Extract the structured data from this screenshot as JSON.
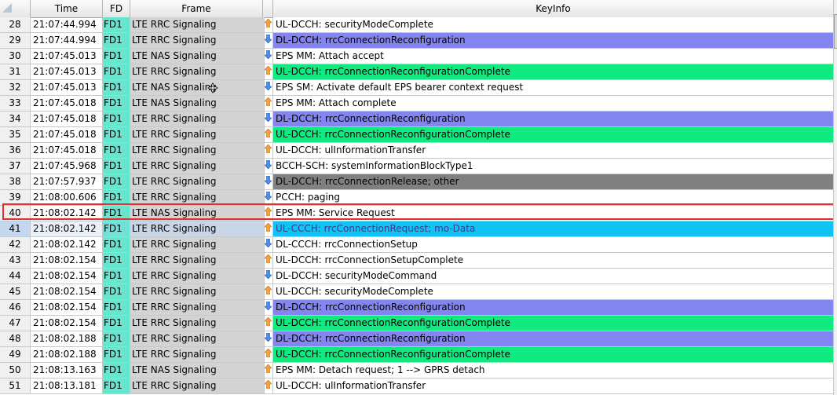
{
  "headers": {
    "time": "Time",
    "fd": "FD",
    "frame": "Frame",
    "keyinfo": "KeyInfo"
  },
  "colors": {
    "fd": "#66e6cf",
    "frame": "#d3d3d3",
    "purple": "#8585f2",
    "green": "#10ea80",
    "gray": "#808080",
    "cyan": "#11c3f5",
    "white": "#ffffff",
    "highlight_border": "#e03030"
  },
  "rows": [
    {
      "num": "28",
      "time": "21:07:44.994",
      "fd": "FD1",
      "frame": "LTE RRC Signaling",
      "dir": "up",
      "key": "UL-DCCH: securityModeComplete",
      "bg": "white"
    },
    {
      "num": "29",
      "time": "21:07:44.994",
      "fd": "FD1",
      "frame": "LTE RRC Signaling",
      "dir": "down",
      "key": "DL-DCCH: rrcConnectionReconfiguration",
      "bg": "purple"
    },
    {
      "num": "30",
      "time": "21:07:45.013",
      "fd": "FD1",
      "frame": "LTE NAS Signaling",
      "dir": "down",
      "key": "EPS MM: Attach accept",
      "bg": "white"
    },
    {
      "num": "31",
      "time": "21:07:45.013",
      "fd": "FD1",
      "frame": "LTE RRC Signaling",
      "dir": "up",
      "key": "UL-DCCH: rrcConnectionReconfigurationComplete",
      "bg": "green"
    },
    {
      "num": "32",
      "time": "21:07:45.013",
      "fd": "FD1",
      "frame": "LTE NAS Signaling",
      "dir": "down",
      "key": "EPS SM: Activate default EPS bearer context request",
      "bg": "white"
    },
    {
      "num": "33",
      "time": "21:07:45.018",
      "fd": "FD1",
      "frame": "LTE NAS Signaling",
      "dir": "up",
      "key": "EPS MM: Attach complete",
      "bg": "white"
    },
    {
      "num": "34",
      "time": "21:07:45.018",
      "fd": "FD1",
      "frame": "LTE RRC Signaling",
      "dir": "down",
      "key": "DL-DCCH: rrcConnectionReconfiguration",
      "bg": "purple"
    },
    {
      "num": "35",
      "time": "21:07:45.018",
      "fd": "FD1",
      "frame": "LTE RRC Signaling",
      "dir": "up",
      "key": "UL-DCCH: rrcConnectionReconfigurationComplete",
      "bg": "green"
    },
    {
      "num": "36",
      "time": "21:07:45.018",
      "fd": "FD1",
      "frame": "LTE RRC Signaling",
      "dir": "up",
      "key": "UL-DCCH: ulInformationTransfer",
      "bg": "white"
    },
    {
      "num": "37",
      "time": "21:07:45.968",
      "fd": "FD1",
      "frame": "LTE RRC Signaling",
      "dir": "down",
      "key": "BCCH-SCH: systemInformationBlockType1",
      "bg": "white"
    },
    {
      "num": "38",
      "time": "21:07:57.937",
      "fd": "FD1",
      "frame": "LTE RRC Signaling",
      "dir": "down",
      "key": "DL-DCCH: rrcConnectionRelease;  other",
      "bg": "gray"
    },
    {
      "num": "39",
      "time": "21:08:00.606",
      "fd": "FD1",
      "frame": "LTE RRC Signaling",
      "dir": "down",
      "key": "PCCH: paging",
      "bg": "white"
    },
    {
      "num": "40",
      "time": "21:08:02.142",
      "fd": "FD1",
      "frame": "LTE NAS Signaling",
      "dir": "up",
      "key": "EPS MM: Service Request",
      "bg": "white"
    },
    {
      "num": "41",
      "time": "21:08:02.142",
      "fd": "FD1",
      "frame": "LTE RRC Signaling",
      "dir": "up",
      "key": "UL-CCCH: rrcConnectionRequest;  mo-Data",
      "bg": "cyan",
      "selected": true
    },
    {
      "num": "42",
      "time": "21:08:02.142",
      "fd": "FD1",
      "frame": "LTE RRC Signaling",
      "dir": "down",
      "key": "DL-CCCH: rrcConnectionSetup",
      "bg": "white"
    },
    {
      "num": "43",
      "time": "21:08:02.154",
      "fd": "FD1",
      "frame": "LTE RRC Signaling",
      "dir": "up",
      "key": "UL-DCCH: rrcConnectionSetupComplete",
      "bg": "white"
    },
    {
      "num": "44",
      "time": "21:08:02.154",
      "fd": "FD1",
      "frame": "LTE RRC Signaling",
      "dir": "down",
      "key": "DL-DCCH: securityModeCommand",
      "bg": "white"
    },
    {
      "num": "45",
      "time": "21:08:02.154",
      "fd": "FD1",
      "frame": "LTE RRC Signaling",
      "dir": "up",
      "key": "UL-DCCH: securityModeComplete",
      "bg": "white"
    },
    {
      "num": "46",
      "time": "21:08:02.154",
      "fd": "FD1",
      "frame": "LTE RRC Signaling",
      "dir": "down",
      "key": "DL-DCCH: rrcConnectionReconfiguration",
      "bg": "purple"
    },
    {
      "num": "47",
      "time": "21:08:02.154",
      "fd": "FD1",
      "frame": "LTE RRC Signaling",
      "dir": "up",
      "key": "UL-DCCH: rrcConnectionReconfigurationComplete",
      "bg": "green"
    },
    {
      "num": "48",
      "time": "21:08:02.188",
      "fd": "FD1",
      "frame": "LTE RRC Signaling",
      "dir": "down",
      "key": "DL-DCCH: rrcConnectionReconfiguration",
      "bg": "purple"
    },
    {
      "num": "49",
      "time": "21:08:02.188",
      "fd": "FD1",
      "frame": "LTE RRC Signaling",
      "dir": "up",
      "key": "UL-DCCH: rrcConnectionReconfigurationComplete",
      "bg": "green"
    },
    {
      "num": "50",
      "time": "21:08:13.163",
      "fd": "FD1",
      "frame": "LTE NAS Signaling",
      "dir": "up",
      "key": "EPS MM: Detach request;  1 --> GPRS detach",
      "bg": "white"
    },
    {
      "num": "51",
      "time": "21:08:13.181",
      "fd": "FD1",
      "frame": "LTE RRC Signaling",
      "dir": "up",
      "key": "UL-DCCH: ulInformationTransfer",
      "bg": "white"
    }
  ]
}
